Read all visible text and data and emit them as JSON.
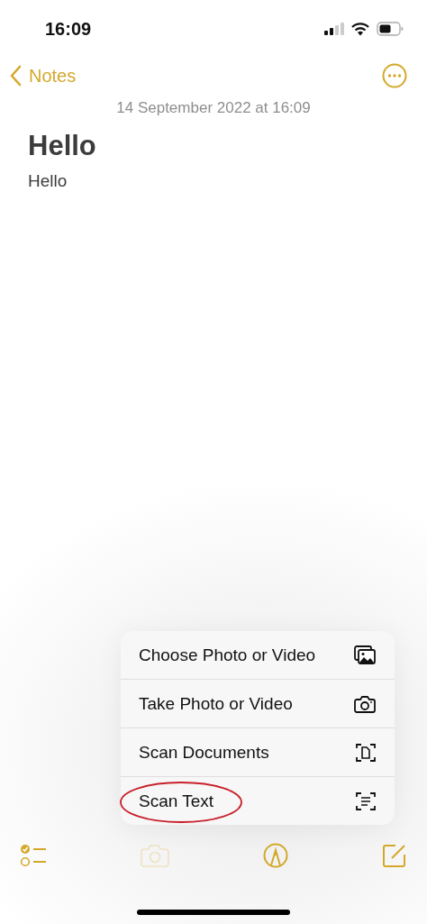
{
  "status_bar": {
    "time": "16:09"
  },
  "nav": {
    "back_label": "Notes"
  },
  "note": {
    "date": "14 September 2022 at 16:09",
    "title": "Hello",
    "body": "Hello"
  },
  "menu": [
    {
      "label": "Choose Photo or Video",
      "kind": "gallery",
      "circled": false
    },
    {
      "label": "Take Photo or Video",
      "kind": "camera",
      "circled": false
    },
    {
      "label": "Scan Documents",
      "kind": "scan-doc",
      "circled": false
    },
    {
      "label": "Scan Text",
      "kind": "scan-text",
      "circled": true
    }
  ],
  "toolbar": [
    {
      "kind": "checklist",
      "disabled": false
    },
    {
      "kind": "camera",
      "disabled": true
    },
    {
      "kind": "markup",
      "disabled": false
    },
    {
      "kind": "compose",
      "disabled": false
    }
  ]
}
